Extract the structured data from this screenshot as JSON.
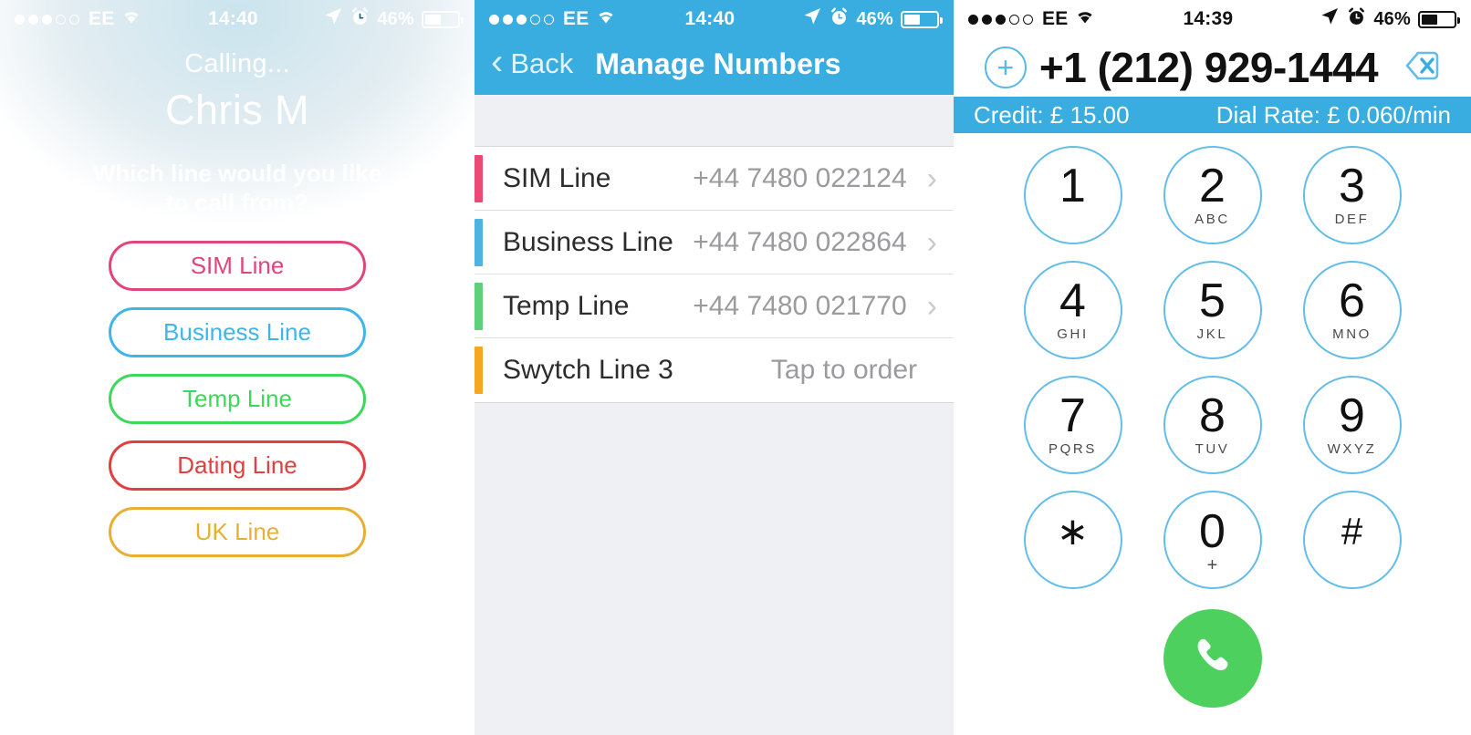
{
  "calling_screen": {
    "status_bar": {
      "signal_filled": 3,
      "signal_empty": 2,
      "carrier": "EE",
      "wifi_icon": "wifi-icon",
      "time": "14:40",
      "location_icon": "location-arrow-icon",
      "alarm_icon": "alarm-clock-icon",
      "battery_percent": "46%",
      "battery_icon": "battery-icon"
    },
    "status_label": "Calling...",
    "contact_name": "Chris M",
    "prompt": "Which line would you like to call from?",
    "line_buttons": [
      {
        "label": "SIM Line",
        "color": "#e0457e"
      },
      {
        "label": "Business Line",
        "color": "#3fb5e8"
      },
      {
        "label": "Temp Line",
        "color": "#3dd75c"
      },
      {
        "label": "Dating Line",
        "color": "#e0403f"
      },
      {
        "label": "UK Line",
        "color": "#e8b032"
      }
    ]
  },
  "manage_screen": {
    "status_bar": {
      "signal_filled": 3,
      "signal_empty": 2,
      "carrier": "EE",
      "wifi_icon": "wifi-icon",
      "time": "14:40",
      "location_icon": "location-arrow-icon",
      "alarm_icon": "alarm-clock-icon",
      "battery_percent": "46%",
      "battery_icon": "battery-icon"
    },
    "nav": {
      "back_label": "Back",
      "back_icon": "chevron-left-icon",
      "title": "Manage Numbers"
    },
    "rows": [
      {
        "label": "SIM Line",
        "value": "+44 7480 022124",
        "color": "#ec4a74",
        "chevron": "›"
      },
      {
        "label": "Business Line",
        "value": "+44 7480 022864",
        "color": "#4eb3e0",
        "chevron": "›"
      },
      {
        "label": "Temp Line",
        "value": "+44 7480 021770",
        "color": "#5ed07a",
        "chevron": "›"
      },
      {
        "label": "Swytch Line 3",
        "value": "Tap to order",
        "color": "#f5a623",
        "chevron": ""
      }
    ]
  },
  "dial_screen": {
    "status_bar": {
      "signal_filled": 3,
      "signal_empty": 2,
      "carrier": "EE",
      "wifi_icon": "wifi-icon",
      "time": "14:39",
      "location_icon": "location-arrow-icon",
      "alarm_icon": "alarm-clock-icon",
      "battery_percent": "46%",
      "battery_icon": "battery-icon"
    },
    "add_contact_icon": "plus-circle-icon",
    "dialed_number": "+1 (212) 929-1444",
    "backspace_icon": "backspace-delete-icon",
    "credit_label": "Credit: £ 15.00",
    "dial_rate_label": "Dial Rate: £ 0.060/min",
    "accent_color": "#3aade0",
    "key_border_color": "#63bde9",
    "call_button_color": "#4ed05f",
    "call_icon": "phone-handset-icon",
    "keys": [
      {
        "digit": "1",
        "letters": ""
      },
      {
        "digit": "2",
        "letters": "ABC"
      },
      {
        "digit": "3",
        "letters": "DEF"
      },
      {
        "digit": "4",
        "letters": "GHI"
      },
      {
        "digit": "5",
        "letters": "JKL"
      },
      {
        "digit": "6",
        "letters": "MNO"
      },
      {
        "digit": "7",
        "letters": "PQRS"
      },
      {
        "digit": "8",
        "letters": "TUV"
      },
      {
        "digit": "9",
        "letters": "WXYZ"
      },
      {
        "digit": "∗",
        "letters": ""
      },
      {
        "digit": "0",
        "letters": "+"
      },
      {
        "digit": "#",
        "letters": ""
      }
    ]
  }
}
